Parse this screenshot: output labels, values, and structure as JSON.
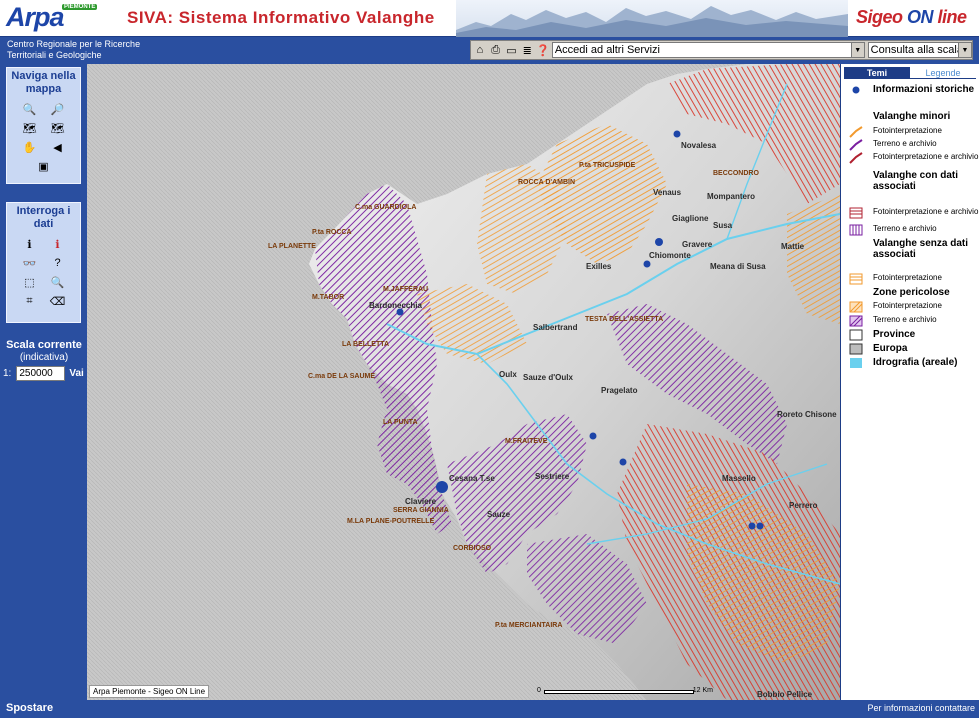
{
  "header": {
    "logo_text": "Arpa",
    "logo_badge": "PIEMONTE",
    "title": "SIVA: Sistema Informativo Valanghe",
    "brand_a": "Sigeo ",
    "brand_b": "ON",
    "brand_c": " line",
    "org_line1": "Centro Regionale per le Ricerche",
    "org_line2": "Territoriali e Geologiche"
  },
  "toolbar": {
    "services_select": "Accedi ad altri Servizi",
    "scale_select": "Consulta alla scala"
  },
  "left_panel": {
    "nav_title": "Naviga nella mappa",
    "query_title": "Interroga i dati",
    "scale_title": "Scala corrente",
    "scale_subtitle": "(indicativa)",
    "scale_prefix": "1:",
    "scale_value": "250000",
    "scale_button": "Vai"
  },
  "map": {
    "credits": "Arpa Piemonte - Sigeo ON Line",
    "scalebar_zero": "0",
    "scalebar_unit": "12 Km",
    "places": [
      {
        "name": "Bardonecchia",
        "type": "city"
      },
      {
        "name": "Oulx",
        "type": "city"
      },
      {
        "name": "Sauze d'Oulx",
        "type": "city"
      },
      {
        "name": "Cesana T.se",
        "type": "city"
      },
      {
        "name": "Claviere",
        "type": "city"
      },
      {
        "name": "Sestriere",
        "type": "city"
      },
      {
        "name": "Sauze",
        "type": "city"
      },
      {
        "name": "Pragelato",
        "type": "city"
      },
      {
        "name": "Salbertrand",
        "type": "city"
      },
      {
        "name": "Exilles",
        "type": "city"
      },
      {
        "name": "Chiomonte",
        "type": "city"
      },
      {
        "name": "Gravere",
        "type": "city"
      },
      {
        "name": "Susa",
        "type": "city"
      },
      {
        "name": "Mattie",
        "type": "city"
      },
      {
        "name": "Meana di Susa",
        "type": "city"
      },
      {
        "name": "Novalesa",
        "type": "city"
      },
      {
        "name": "Mompantero",
        "type": "city"
      },
      {
        "name": "Venaus",
        "type": "city"
      },
      {
        "name": "Giaglione",
        "type": "city"
      },
      {
        "name": "Perrero",
        "type": "city"
      },
      {
        "name": "Roreto Chisone",
        "type": "city"
      },
      {
        "name": "Massello",
        "type": "city"
      },
      {
        "name": "Bobbio Pellice",
        "type": "city"
      },
      {
        "name": "M.JAFFERAU",
        "type": "peak"
      },
      {
        "name": "LA PLANETTE",
        "type": "peak"
      },
      {
        "name": "ROCCA D'AMBIN",
        "type": "peak"
      },
      {
        "name": "C.ma GUARDIOLA",
        "type": "peak"
      },
      {
        "name": "P.ta ROCCA",
        "type": "peak"
      },
      {
        "name": "M.TABOR",
        "type": "peak"
      },
      {
        "name": "LA BELLETTA",
        "type": "peak"
      },
      {
        "name": "C.ma DE LA SAUME",
        "type": "peak"
      },
      {
        "name": "LA PUNTA",
        "type": "peak"
      },
      {
        "name": "SERRA GIANNIA",
        "type": "peak"
      },
      {
        "name": "M.LA PLANE-POUTRELLE",
        "type": "peak"
      },
      {
        "name": "P.ta MERCIANTAIRA",
        "type": "peak"
      },
      {
        "name": "TESTA DELL'ASSIETTA",
        "type": "peak"
      },
      {
        "name": "P.ta TRICUSPIDE",
        "type": "peak"
      },
      {
        "name": "BECCONDRO",
        "type": "peak"
      },
      {
        "name": "M.FRAITEVE",
        "type": "peak"
      },
      {
        "name": "CORBIOSO",
        "type": "peak"
      }
    ]
  },
  "legend": {
    "tab_active": "Temi",
    "tab_inactive": "Legende",
    "info_storiche": "Informazioni storiche",
    "valanghe_minori": "Valanghe minori",
    "fotointerpretazione": "Fotointerpretazione",
    "terreno_archivio": "Terreno e archivio",
    "foto_terreno": "Fotointerpretazione e archivio",
    "valanghe_dati": "Valanghe con dati associati",
    "valanghe_senza": "Valanghe senza dati associati",
    "zone_pericolose": "Zone pericolose",
    "province": "Province",
    "europa": "Europa",
    "idrografia": "Idrografia (areale)"
  },
  "footer": {
    "status": "Spostare",
    "contact": "Per informazioni contattare"
  },
  "colors": {
    "accent": "#2a4fa0",
    "title_red": "#c8262c",
    "avalanche_orange": "#f29a2e",
    "avalanche_red": "#d9362a",
    "avalanche_purple": "#7a1fa0",
    "water": "#6ad0ee"
  }
}
